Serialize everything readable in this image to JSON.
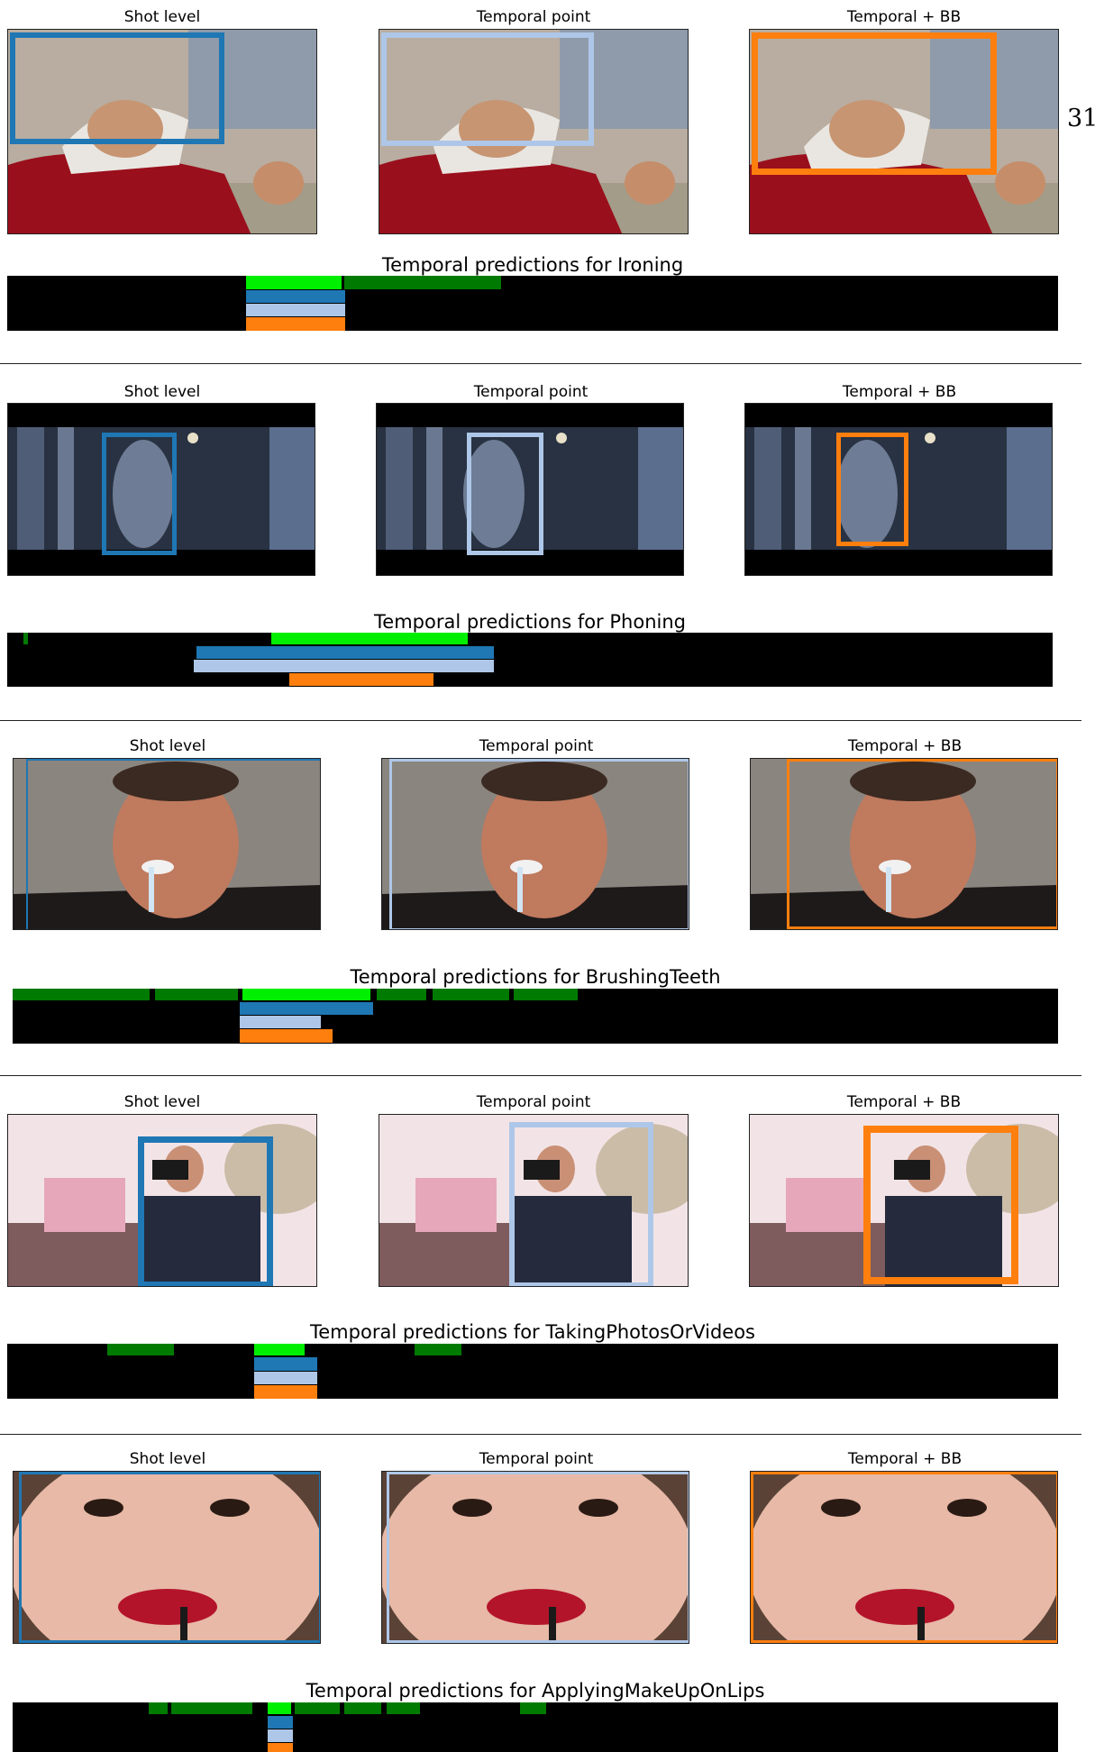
{
  "page": {
    "number": "31"
  },
  "panel_titles": {
    "shot": "Shot level",
    "point": "Temporal point",
    "bb": "Temporal + BB"
  },
  "colors": {
    "gt_bright": "#00ee00",
    "gt_dark": "#007a00",
    "shot": "#1f77b4",
    "point": "#aec7e8",
    "bb": "#ff7f0e"
  },
  "examples": [
    {
      "id": "ironing",
      "timeline_title": "Temporal predictions for Ironing",
      "scene": "ironing"
    },
    {
      "id": "phoning",
      "timeline_title": "Temporal predictions for Phoning",
      "scene": "phoning"
    },
    {
      "id": "brushing",
      "timeline_title": "Temporal predictions for BrushingTeeth",
      "scene": "brushing"
    },
    {
      "id": "photos",
      "timeline_title": "Temporal predictions for TakingPhotosOrVideos",
      "scene": "photos"
    },
    {
      "id": "makeup",
      "timeline_title": "Temporal predictions for ApplyingMakeUpOnLips",
      "scene": "makeup"
    }
  ]
}
